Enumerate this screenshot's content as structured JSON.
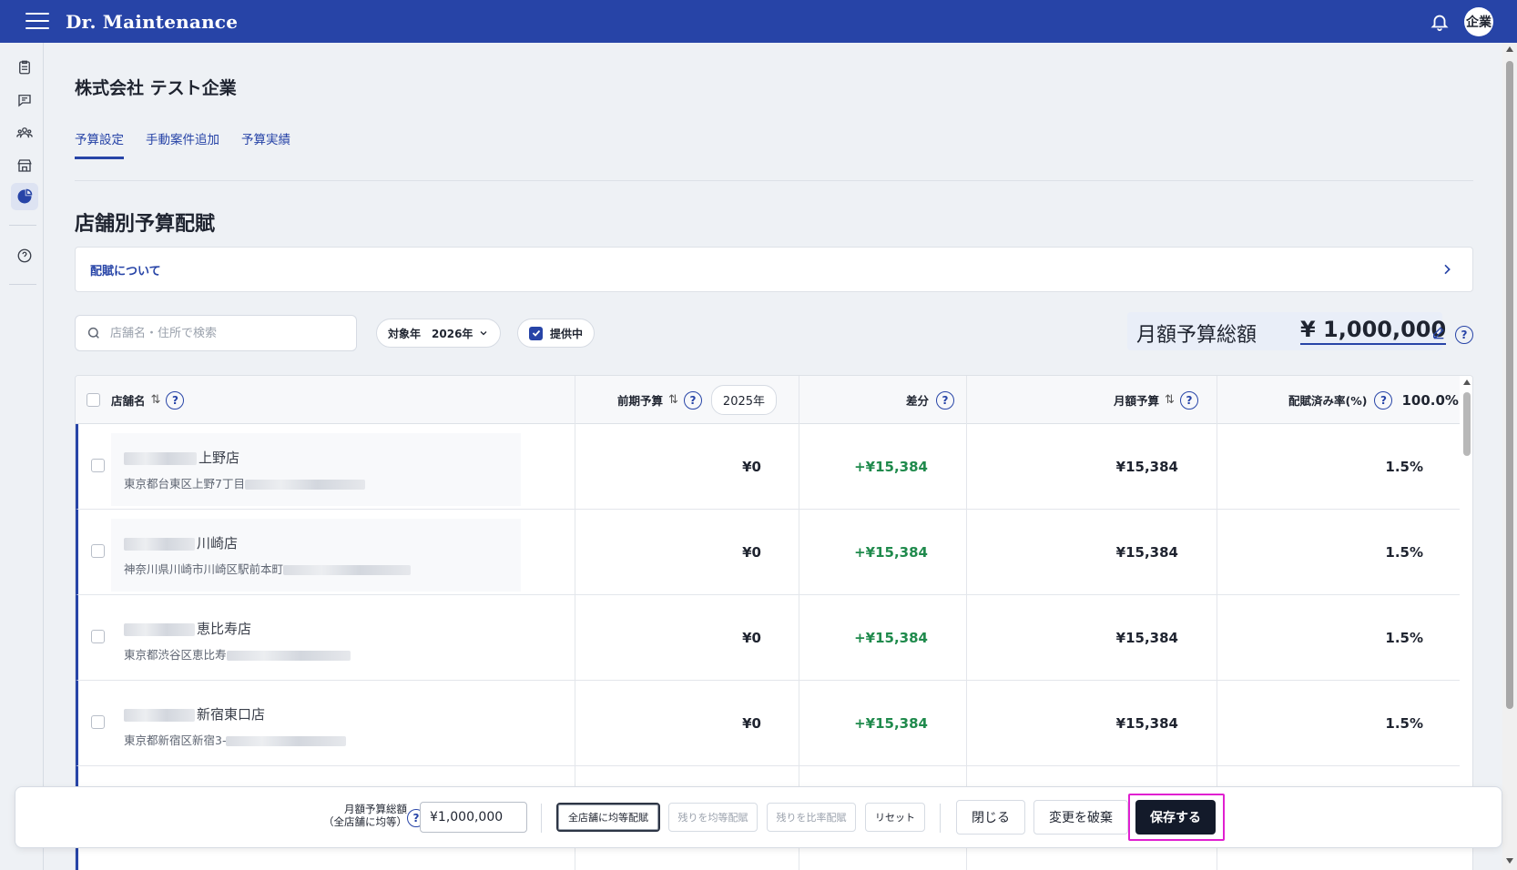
{
  "app": {
    "brand": "Dr. Maintenance",
    "avatar": "企業"
  },
  "company": "株式会社 テスト企業",
  "tabs": [
    "予算設定",
    "手動案件追加",
    "予算実績"
  ],
  "section_title": "店舗別予算配賦",
  "info_panel": {
    "label": "配賦について"
  },
  "filters": {
    "search_placeholder": "店舗名・住所で検索",
    "year_label": "対象年",
    "year_value": "2026年",
    "active_label": "提供中"
  },
  "budget_total": {
    "label": "月額予算総額",
    "value": "¥ 1,000,000"
  },
  "table": {
    "headers": {
      "store": "店舗名",
      "prev": "前期予算",
      "prev_year": "2025年",
      "diff": "差分",
      "monthly": "月額予算",
      "rate": "配賦済み率(%)",
      "rate_total": "100.0%"
    },
    "rows": [
      {
        "name": "上野店",
        "address": "東京都台東区上野7丁目",
        "prev": "¥0",
        "diff": "+¥15,384",
        "monthly": "¥15,384",
        "rate": "1.5%"
      },
      {
        "name": "川崎店",
        "address": "神奈川県川崎市川崎区駅前本町",
        "prev": "¥0",
        "diff": "+¥15,384",
        "monthly": "¥15,384",
        "rate": "1.5%"
      },
      {
        "name": "恵比寿店",
        "address": "東京都渋谷区恵比寿",
        "prev": "¥0",
        "diff": "+¥15,384",
        "monthly": "¥15,384",
        "rate": "1.5%"
      },
      {
        "name": "新宿東口店",
        "address": "東京都新宿区新宿3-",
        "prev": "¥0",
        "diff": "+¥15,384",
        "monthly": "¥15,384",
        "rate": "1.5%"
      }
    ]
  },
  "bottom_bar": {
    "label_line1": "月額予算総額",
    "label_line2": "（全店舗に均等）",
    "input_value": "¥1,000,000",
    "btn_equal_all": "全店舗に均等配賦",
    "btn_equal_rest": "残りを均等配賦",
    "btn_ratio_rest": "残りを比率配賦",
    "btn_reset": "リセット",
    "btn_close": "閉じる",
    "btn_discard": "変更を破棄",
    "btn_save": "保存する"
  },
  "colors": {
    "brand": "#2744a7",
    "positive": "#1f8a4c",
    "primary_button": "#131a2a",
    "focus": "#e020d0"
  }
}
